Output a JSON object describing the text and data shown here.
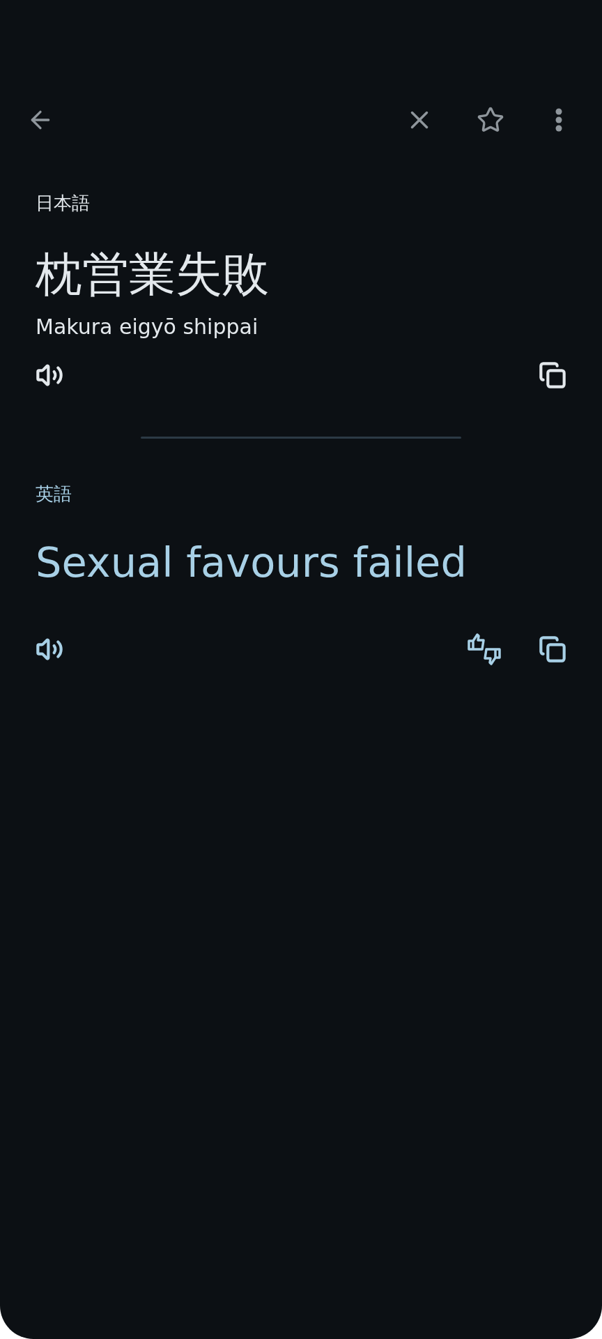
{
  "source": {
    "language": "日本語",
    "text": "枕営業失敗",
    "transliteration": "Makura eigyō shippai"
  },
  "target": {
    "language": "英語",
    "text": "Sexual favours failed"
  }
}
